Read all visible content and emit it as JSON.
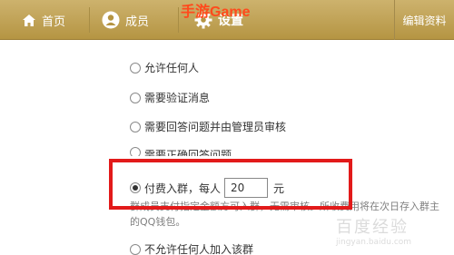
{
  "watermark": {
    "top": "手游Game",
    "bottom_big": "百度经验",
    "bottom_small": "jingyan.baidu.com"
  },
  "nav": {
    "home": "首页",
    "members": "成员",
    "settings": "设置",
    "edit": "编辑资料"
  },
  "options": [
    {
      "label": "允许任何人",
      "checked": false
    },
    {
      "label": "需要验证消息",
      "checked": false
    },
    {
      "label": "需要回答问题并由管理员审核",
      "checked": false
    },
    {
      "label": "需要正确回答问题",
      "checked": false
    },
    {
      "label": "付费入群，每人",
      "checked": true
    },
    {
      "label": "不允许任何人加入该群",
      "checked": false
    }
  ],
  "fee": {
    "amount": "20",
    "unit": "元"
  },
  "fee_description": "群成员支付指定金额方可入群，无需审核。所收费用将在次日存入群主的QQ钱包。",
  "colors": {
    "topbar": "#b59543",
    "highlight": "#e21a1a",
    "watermark": "#ff4a1c"
  }
}
